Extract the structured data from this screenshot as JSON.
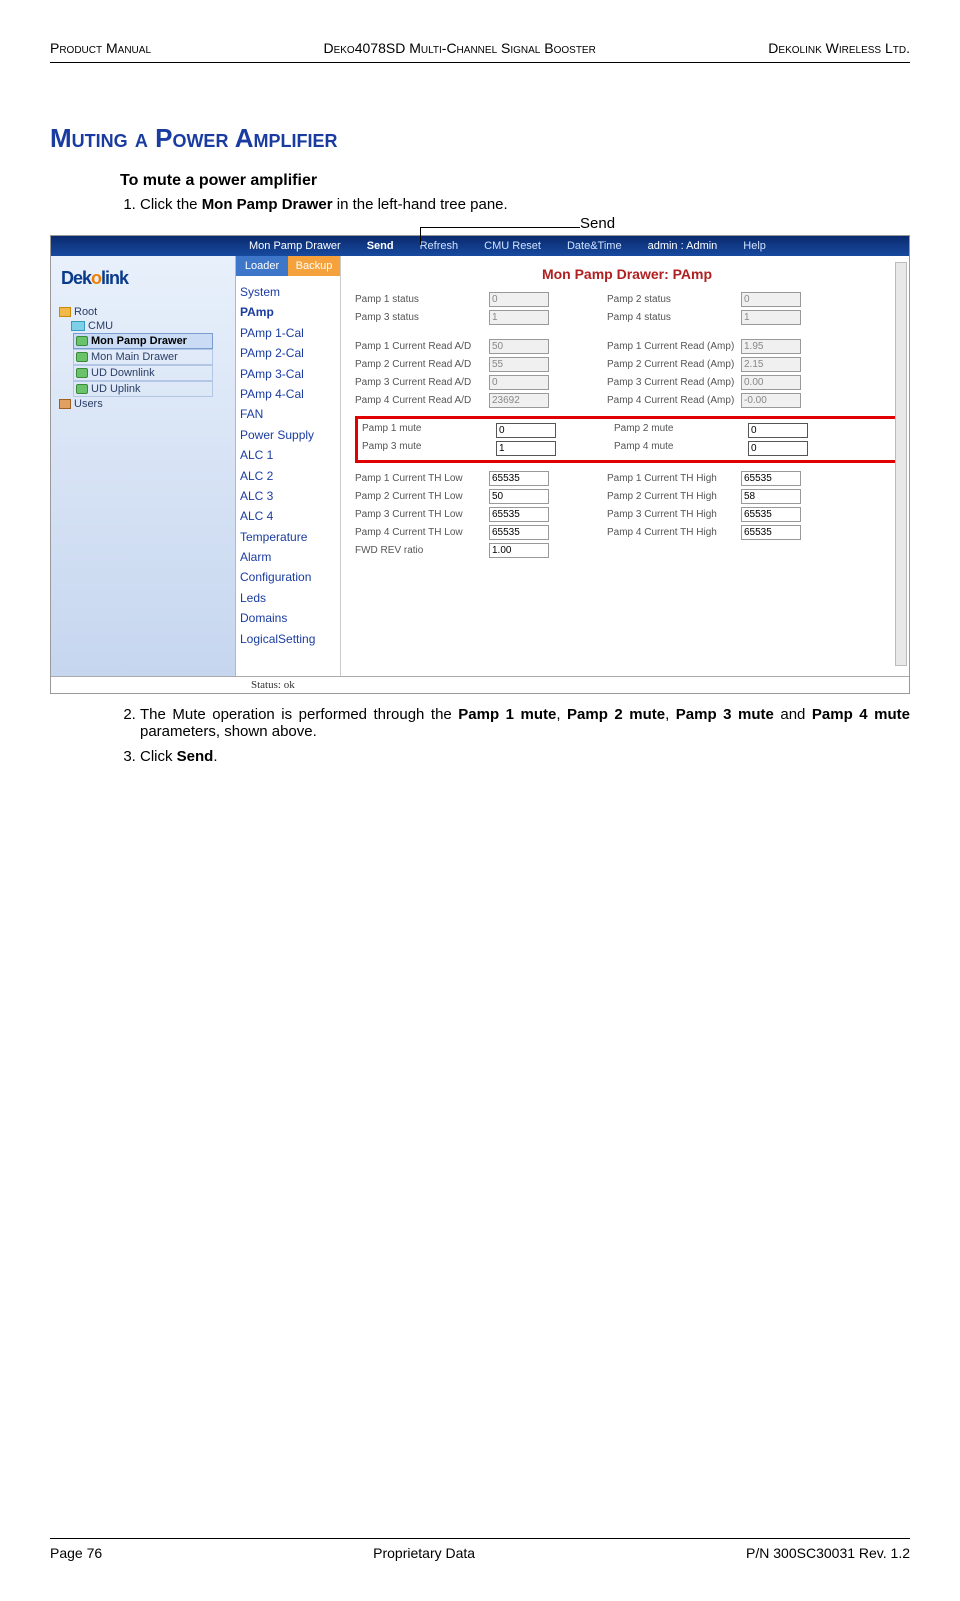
{
  "header": {
    "left": "Product Manual",
    "center": "Deko4078SD Multi-Channel Signal Booster",
    "right": "Dekolink Wireless Ltd."
  },
  "section_title": "Muting a Power Amplifier",
  "subheading": "To mute a power amplifier",
  "step1_pre": "Click the ",
  "step1_bold": "Mon Pamp Drawer",
  "step1_post": " in the left-hand tree pane.",
  "send_callout": "Send",
  "ui": {
    "titlebar": {
      "crumb": "Mon Pamp Drawer",
      "send": "Send",
      "refresh": "Refresh",
      "cmu_reset": "CMU Reset",
      "datetime": "Date&Time",
      "admin": "admin : Admin",
      "help": "Help"
    },
    "tree": {
      "root": "Root",
      "cmu": "CMU",
      "mon_pamp": "Mon Pamp Drawer",
      "mon_main": "Mon Main Drawer",
      "ud_down": "UD Downlink",
      "ud_up": "UD Uplink",
      "users": "Users"
    },
    "midtabs": {
      "loader": "Loader",
      "backup": "Backup"
    },
    "midlist": [
      "System",
      "PAmp",
      "PAmp 1-Cal",
      "PAmp 2-Cal",
      "PAmp 3-Cal",
      "PAmp 4-Cal",
      "FAN",
      "Power Supply",
      "ALC 1",
      "ALC 2",
      "ALC 3",
      "ALC 4",
      "Temperature",
      "Alarm",
      "Configuration",
      "Leds",
      "Domains",
      "LogicalSetting"
    ],
    "drawer_title": "Mon Pamp Drawer: PAmp",
    "status": {
      "p1s_l": "Pamp 1 status",
      "p1s_v": "0",
      "p2s_l": "Pamp 2 status",
      "p2s_v": "0",
      "p3s_l": "Pamp 3 status",
      "p3s_v": "1",
      "p4s_l": "Pamp 4 status",
      "p4s_v": "1"
    },
    "cur_ad": {
      "p1_l": "Pamp 1 Current Read A/D",
      "p1_v": "50",
      "p2_l": "Pamp 2 Current Read A/D",
      "p2_v": "55",
      "p3_l": "Pamp 3 Current Read A/D",
      "p3_v": "0",
      "p4_l": "Pamp 4 Current Read A/D",
      "p4_v": "23692"
    },
    "cur_amp": {
      "p1_l": "Pamp 1 Current Read (Amp)",
      "p1_v": "1.95",
      "p2_l": "Pamp 2 Current Read (Amp)",
      "p2_v": "2.15",
      "p3_l": "Pamp 3 Current Read (Amp)",
      "p3_v": "0.00",
      "p4_l": "Pamp 4 Current Read (Amp)",
      "p4_v": "-0.00"
    },
    "mute": {
      "p1_l": "Pamp 1 mute",
      "p1_v": "0",
      "p2_l": "Pamp 2 mute",
      "p2_v": "0",
      "p3_l": "Pamp 3 mute",
      "p3_v": "1",
      "p4_l": "Pamp 4 mute",
      "p4_v": "0"
    },
    "th_low": {
      "p1_l": "Pamp 1 Current TH Low",
      "p1_v": "65535",
      "p2_l": "Pamp 2 Current TH Low",
      "p2_v": "50",
      "p3_l": "Pamp 3 Current TH Low",
      "p3_v": "65535",
      "p4_l": "Pamp 4 Current TH Low",
      "p4_v": "65535"
    },
    "th_high": {
      "p1_l": "Pamp 1 Current TH High",
      "p1_v": "65535",
      "p2_l": "Pamp 2 Current TH High",
      "p2_v": "58",
      "p3_l": "Pamp 3 Current TH High",
      "p3_v": "65535",
      "p4_l": "Pamp 4 Current TH High",
      "p4_v": "65535"
    },
    "fwd": {
      "l": "FWD REV ratio",
      "v": "1.00"
    },
    "statusbar": "Status: ok"
  },
  "step2_pre": "The Mute operation is performed through the ",
  "step2_b1": "Pamp 1 mute",
  "step2_m1": ", ",
  "step2_b2": "Pamp 2 mute",
  "step2_m2": ", ",
  "step2_b3": "Pamp 3 mute",
  "step2_m3": " and ",
  "step2_b4": "Pamp 4 mute",
  "step2_post": " parameters, shown above.",
  "step3_pre": "Click ",
  "step3_b": "Send",
  "step3_post": ".",
  "footer": {
    "left": "Page 76",
    "center": "Proprietary Data",
    "right": "P/N 300SC30031 Rev. 1.2"
  }
}
